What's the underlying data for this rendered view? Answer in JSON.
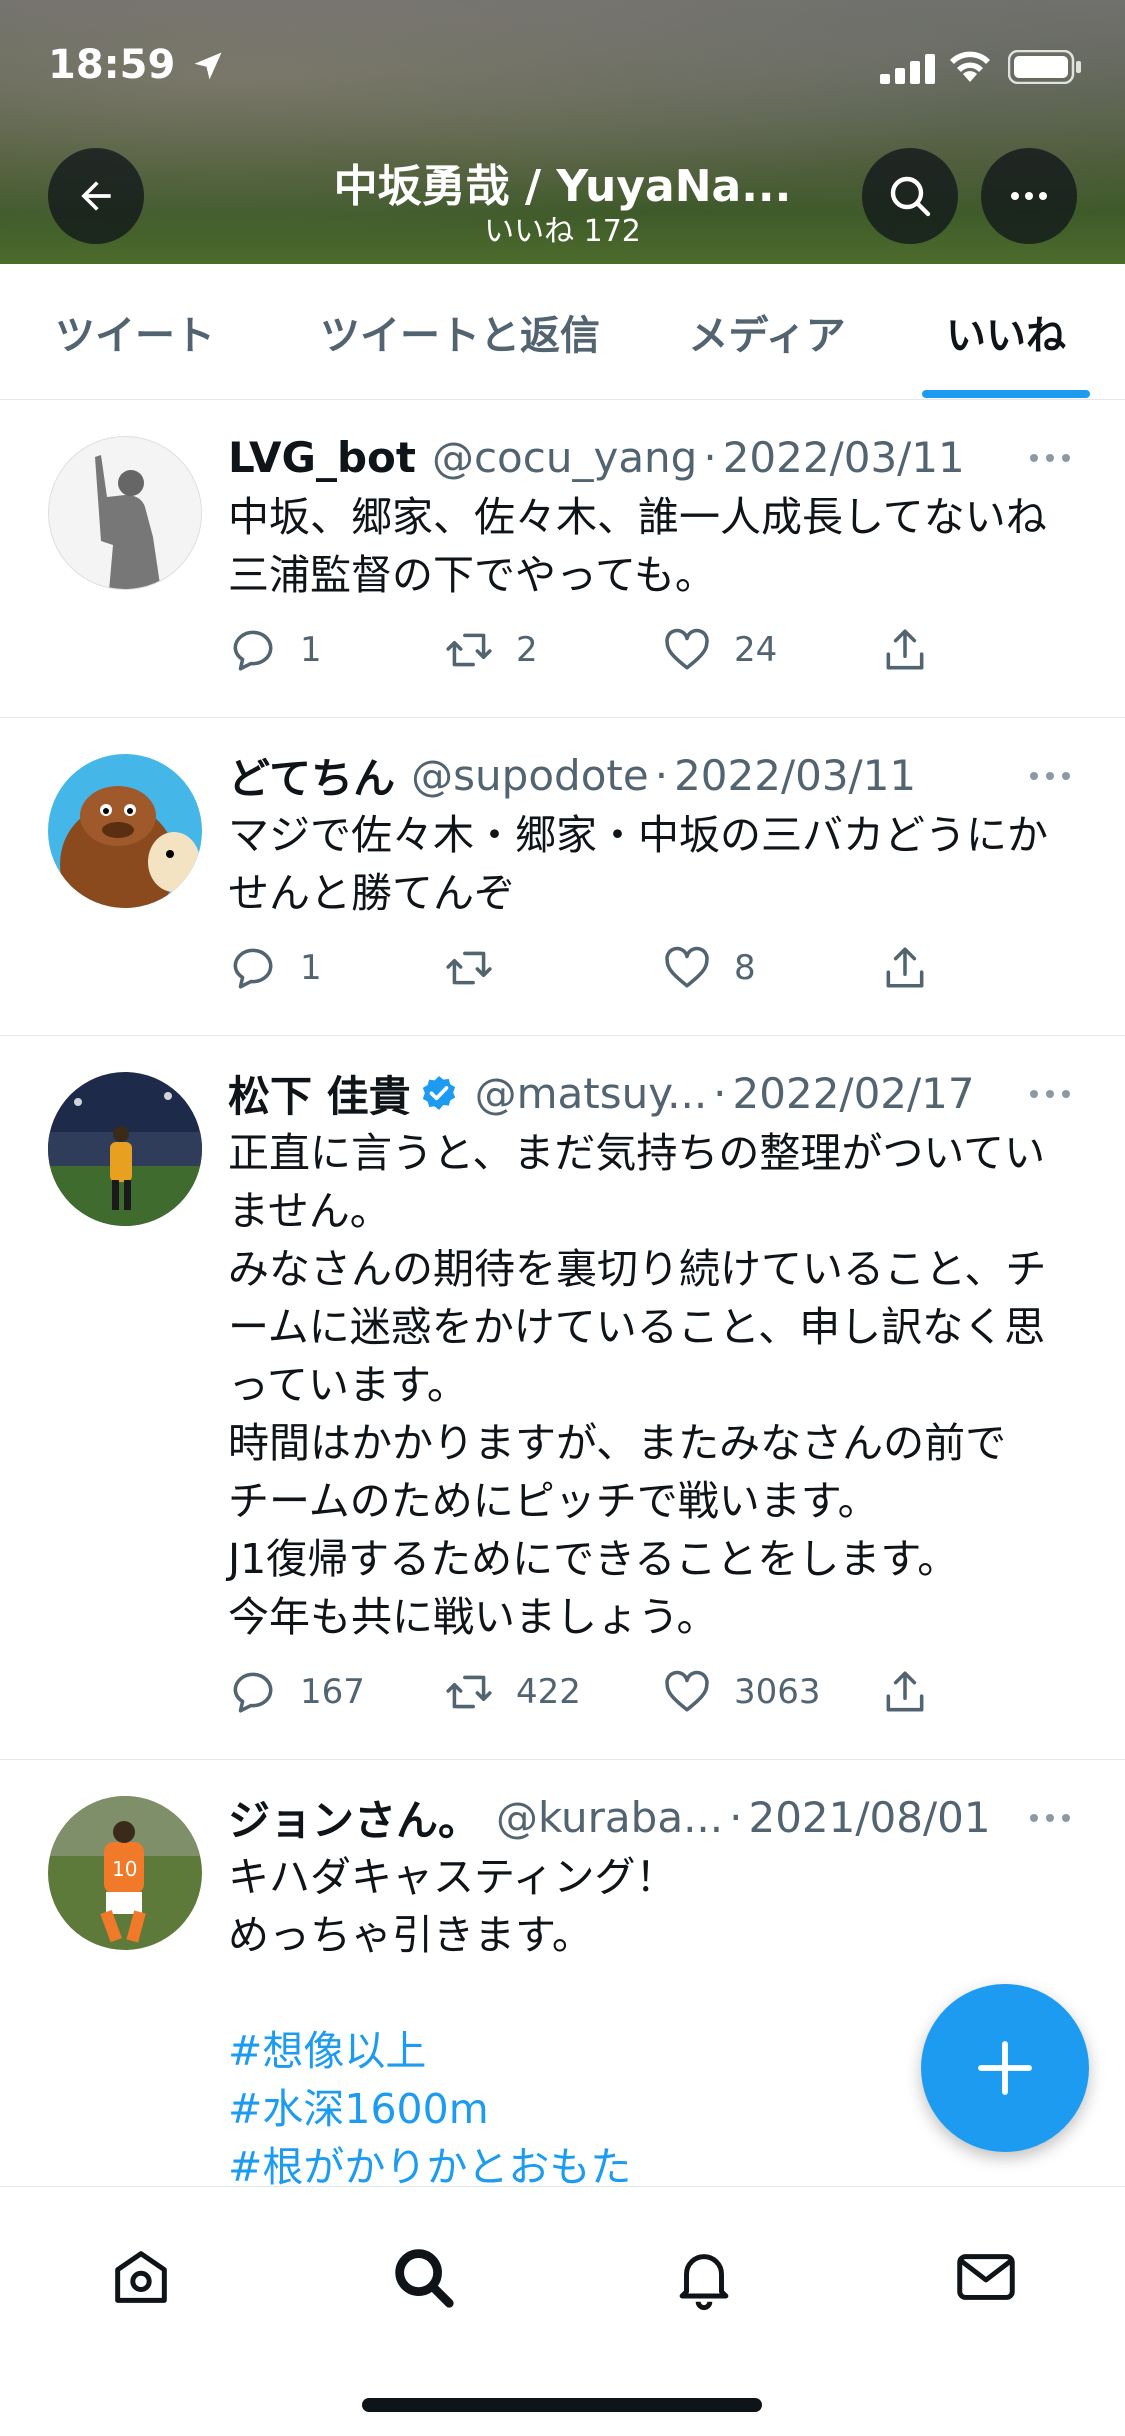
{
  "status_bar": {
    "time": "18:59"
  },
  "header": {
    "title": "中坂勇哉 / YuyaNa...",
    "subtitle": "いいね 172",
    "colors": {
      "button_bg": "#0f1419"
    }
  },
  "tabs": [
    {
      "label": "ツイート",
      "active": false
    },
    {
      "label": "ツイートと返信",
      "active": false
    },
    {
      "label": "メディア",
      "active": false
    },
    {
      "label": "いいね",
      "active": true
    }
  ],
  "accent_color": "#1d9bf0",
  "tweets": [
    {
      "name": "LVG_bot",
      "handle": "@cocu_yang",
      "date": "2022/03/11",
      "verified": false,
      "lines": [
        "中坂、郷家、佐々木、誰一人成長してないね",
        "三浦監督の下でやっても。"
      ],
      "replies": "1",
      "retweets": "2",
      "likes": "24"
    },
    {
      "name": "どてちん",
      "handle": "@supodote",
      "date": "2022/03/11",
      "verified": false,
      "lines": [
        "マジで佐々木・郷家・中坂の三バカどうにか",
        "せんと勝てんぞ"
      ],
      "replies": "1",
      "retweets": "",
      "likes": "8"
    },
    {
      "name": "松下 佳貴",
      "handle": "@matsuy...",
      "date": "2022/02/17",
      "verified": true,
      "lines": [
        "正直に言うと、まだ気持ちの整理がついてい",
        "ません。",
        "みなさんの期待を裏切り続けていること、チ",
        "ームに迷惑をかけていること、申し訳なく思",
        "っています。",
        "時間はかかりますが、またみなさんの前で",
        "チームのためにピッチで戦います。",
        "J1復帰するためにできることをします。",
        "今年も共に戦いましょう。"
      ],
      "replies": "167",
      "retweets": "422",
      "likes": "3063"
    },
    {
      "name": "ジョンさん。",
      "handle": "@kuraba...",
      "date": "2021/08/01",
      "verified": false,
      "lines": [
        "キハダキャスティング！",
        "めっちゃ引きます。"
      ],
      "hashtags": [
        "#想像以上",
        "#水深1600m",
        "#根がかりかとおもた"
      ]
    }
  ],
  "dot_separator": "·",
  "icons": [
    "location-icon",
    "signal-icon",
    "wifi-icon",
    "battery-icon",
    "back-arrow-icon",
    "search-icon",
    "more-icon",
    "reply-icon",
    "retweet-icon",
    "like-icon",
    "share-icon",
    "compose-plus-icon",
    "home-icon",
    "explore-search-icon",
    "notifications-bell-icon",
    "messages-mail-icon"
  ]
}
